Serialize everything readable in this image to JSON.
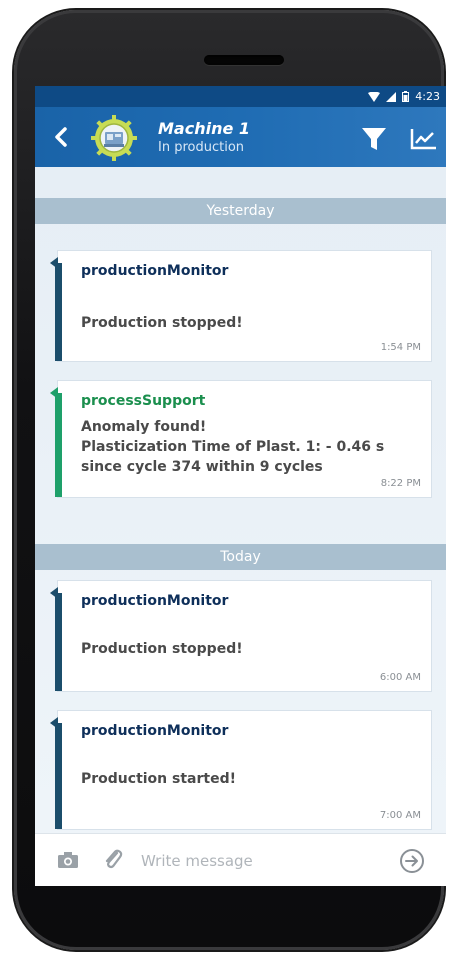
{
  "status_bar": {
    "time": "4:23"
  },
  "header": {
    "title": "Machine 1",
    "subtitle": "In production"
  },
  "groups": [
    {
      "day": "Yesterday",
      "messages": [
        {
          "sender": "productionMonitor",
          "text": "Production stopped!",
          "time": "1:54 PM",
          "accent": "#1b4d6b",
          "sender_color": "#0e2f5a"
        },
        {
          "sender": "processSupport",
          "text": "Anomaly found!\nPlasticization Time of Plast. 1: - 0.46 s\nsince cycle 374 within 9 cycles",
          "time": "8:22 PM",
          "accent": "#1ea06a",
          "sender_color": "#1b8f4e"
        }
      ]
    },
    {
      "day": "Today",
      "messages": [
        {
          "sender": "productionMonitor",
          "text": "Production stopped!",
          "time": "6:00 AM",
          "accent": "#1b4d6b",
          "sender_color": "#0e2f5a"
        },
        {
          "sender": "productionMonitor",
          "text": "Production started!",
          "time": "7:00 AM",
          "accent": "#1b4d6b",
          "sender_color": "#0e2f5a"
        }
      ]
    }
  ],
  "composer": {
    "placeholder": "Write message"
  },
  "colors": {
    "app_bar": "#1f6cb3",
    "divider": "#a9bfcf"
  }
}
